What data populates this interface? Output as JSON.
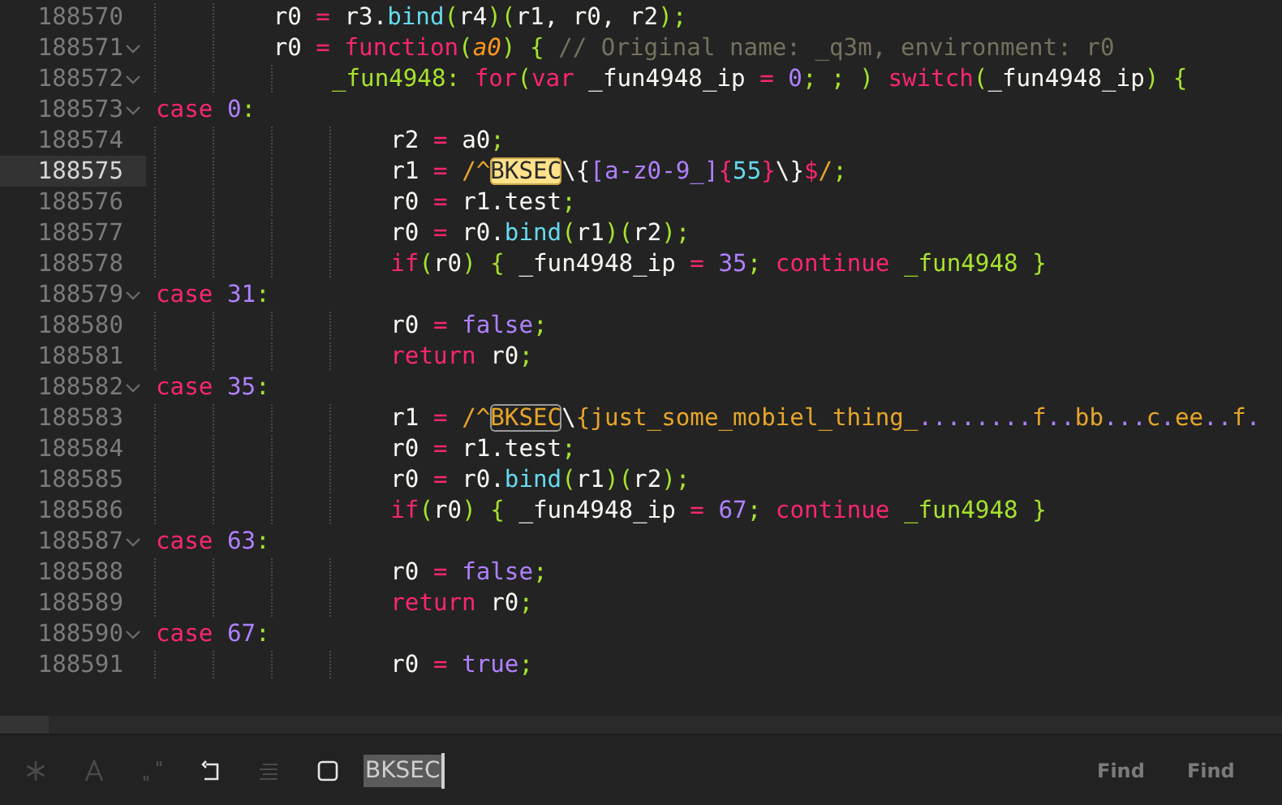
{
  "editor": {
    "lines": [
      {
        "number": "188570",
        "foldable": false,
        "current": false,
        "tokens": [
          {
            "kind": "plain",
            "text": "        r0 "
          },
          {
            "kind": "operator",
            "text": "= "
          },
          {
            "kind": "plain",
            "text": "r3."
          },
          {
            "kind": "func",
            "text": "bind"
          },
          {
            "kind": "punct",
            "text": "("
          },
          {
            "kind": "plain",
            "text": "r4"
          },
          {
            "kind": "punct",
            "text": ")("
          },
          {
            "kind": "plain",
            "text": "r1, r0, r2"
          },
          {
            "kind": "punct",
            "text": ");"
          }
        ]
      },
      {
        "number": "188571",
        "foldable": true,
        "current": false,
        "tokens": [
          {
            "kind": "plain",
            "text": "        r0 "
          },
          {
            "kind": "operator",
            "text": "= "
          },
          {
            "kind": "keyword",
            "text": "function"
          },
          {
            "kind": "punct",
            "text": "("
          },
          {
            "kind": "param",
            "text": "a0"
          },
          {
            "kind": "punct",
            "text": ") { "
          },
          {
            "kind": "comment",
            "text": "// Original name: _q3m, environment: r0"
          }
        ]
      },
      {
        "number": "188572",
        "foldable": true,
        "current": false,
        "tokens": [
          {
            "kind": "label",
            "text": "            _fun4948"
          },
          {
            "kind": "punct",
            "text": ": "
          },
          {
            "kind": "keyword",
            "text": "for"
          },
          {
            "kind": "punct",
            "text": "("
          },
          {
            "kind": "keyword",
            "text": "var "
          },
          {
            "kind": "plain",
            "text": "_fun4948_ip "
          },
          {
            "kind": "operator",
            "text": "= "
          },
          {
            "kind": "number",
            "text": "0"
          },
          {
            "kind": "punct",
            "text": "; ; ) "
          },
          {
            "kind": "keyword",
            "text": "switch"
          },
          {
            "kind": "punct",
            "text": "("
          },
          {
            "kind": "plain",
            "text": "_fun4948_ip"
          },
          {
            "kind": "punct",
            "text": ") {"
          }
        ]
      },
      {
        "number": "188573",
        "foldable": true,
        "current": false,
        "tokens": [
          {
            "kind": "keyword",
            "text": "case "
          },
          {
            "kind": "number",
            "text": "0"
          },
          {
            "kind": "punct",
            "text": ":"
          }
        ]
      },
      {
        "number": "188574",
        "foldable": false,
        "current": false,
        "tokens": [
          {
            "kind": "plain",
            "text": "                r2 "
          },
          {
            "kind": "operator",
            "text": "= "
          },
          {
            "kind": "plain",
            "text": "a0"
          },
          {
            "kind": "punct",
            "text": ";"
          }
        ]
      },
      {
        "number": "188575",
        "foldable": false,
        "current": true,
        "tokens": [
          {
            "kind": "plain",
            "text": "                r1 "
          },
          {
            "kind": "operator",
            "text": "= "
          },
          {
            "kind": "regex",
            "text": "/^"
          },
          {
            "kind": "match",
            "text": "BKSEC",
            "current": true
          },
          {
            "kind": "plain",
            "text": "\\{"
          },
          {
            "kind": "charclass",
            "text": "[a-z0-9_]"
          },
          {
            "kind": "operator",
            "text": "{"
          },
          {
            "kind": "func",
            "text": "55"
          },
          {
            "kind": "operator",
            "text": "}"
          },
          {
            "kind": "plain",
            "text": "\\}"
          },
          {
            "kind": "operator",
            "text": "$"
          },
          {
            "kind": "regex",
            "text": "/"
          },
          {
            "kind": "punct",
            "text": ";"
          }
        ]
      },
      {
        "number": "188576",
        "foldable": false,
        "current": false,
        "tokens": [
          {
            "kind": "plain",
            "text": "                r0 "
          },
          {
            "kind": "operator",
            "text": "= "
          },
          {
            "kind": "plain",
            "text": "r1.test"
          },
          {
            "kind": "punct",
            "text": ";"
          }
        ]
      },
      {
        "number": "188577",
        "foldable": false,
        "current": false,
        "tokens": [
          {
            "kind": "plain",
            "text": "                r0 "
          },
          {
            "kind": "operator",
            "text": "= "
          },
          {
            "kind": "plain",
            "text": "r0."
          },
          {
            "kind": "func",
            "text": "bind"
          },
          {
            "kind": "punct",
            "text": "("
          },
          {
            "kind": "plain",
            "text": "r1"
          },
          {
            "kind": "punct",
            "text": ")("
          },
          {
            "kind": "plain",
            "text": "r2"
          },
          {
            "kind": "punct",
            "text": ");"
          }
        ]
      },
      {
        "number": "188578",
        "foldable": false,
        "current": false,
        "tokens": [
          {
            "kind": "keyword",
            "text": "                if"
          },
          {
            "kind": "punct",
            "text": "("
          },
          {
            "kind": "plain",
            "text": "r0"
          },
          {
            "kind": "punct",
            "text": ") { "
          },
          {
            "kind": "plain",
            "text": "_fun4948_ip "
          },
          {
            "kind": "operator",
            "text": "= "
          },
          {
            "kind": "number",
            "text": "35"
          },
          {
            "kind": "punct",
            "text": "; "
          },
          {
            "kind": "keyword",
            "text": "continue "
          },
          {
            "kind": "label",
            "text": "_fun4948"
          },
          {
            "kind": "punct",
            "text": " }"
          }
        ]
      },
      {
        "number": "188579",
        "foldable": true,
        "current": false,
        "tokens": [
          {
            "kind": "keyword",
            "text": "case "
          },
          {
            "kind": "number",
            "text": "31"
          },
          {
            "kind": "punct",
            "text": ":"
          }
        ]
      },
      {
        "number": "188580",
        "foldable": false,
        "current": false,
        "tokens": [
          {
            "kind": "plain",
            "text": "                r0 "
          },
          {
            "kind": "operator",
            "text": "= "
          },
          {
            "kind": "number",
            "text": "false"
          },
          {
            "kind": "punct",
            "text": ";"
          }
        ]
      },
      {
        "number": "188581",
        "foldable": false,
        "current": false,
        "tokens": [
          {
            "kind": "keyword",
            "text": "                return "
          },
          {
            "kind": "plain",
            "text": "r0"
          },
          {
            "kind": "punct",
            "text": ";"
          }
        ]
      },
      {
        "number": "188582",
        "foldable": true,
        "current": false,
        "tokens": [
          {
            "kind": "keyword",
            "text": "case "
          },
          {
            "kind": "number",
            "text": "35"
          },
          {
            "kind": "punct",
            "text": ":"
          }
        ]
      },
      {
        "number": "188583",
        "foldable": false,
        "current": false,
        "tokens": [
          {
            "kind": "plain",
            "text": "                r1 "
          },
          {
            "kind": "operator",
            "text": "= "
          },
          {
            "kind": "regex",
            "text": "/^"
          },
          {
            "kind": "match",
            "text": "BKSEC",
            "current": false
          },
          {
            "kind": "plain",
            "text": "\\"
          },
          {
            "kind": "regex",
            "text": "{just_some_mobiel_thing_"
          },
          {
            "kind": "charclass",
            "text": "........"
          },
          {
            "kind": "regex",
            "text": "f"
          },
          {
            "kind": "charclass",
            "text": ".."
          },
          {
            "kind": "regex",
            "text": "bb"
          },
          {
            "kind": "charclass",
            "text": "..."
          },
          {
            "kind": "regex",
            "text": "c"
          },
          {
            "kind": "charclass",
            "text": "."
          },
          {
            "kind": "regex",
            "text": "ee"
          },
          {
            "kind": "charclass",
            "text": ".."
          },
          {
            "kind": "regex",
            "text": "f"
          },
          {
            "kind": "charclass",
            "text": "."
          }
        ]
      },
      {
        "number": "188584",
        "foldable": false,
        "current": false,
        "tokens": [
          {
            "kind": "plain",
            "text": "                r0 "
          },
          {
            "kind": "operator",
            "text": "= "
          },
          {
            "kind": "plain",
            "text": "r1.test"
          },
          {
            "kind": "punct",
            "text": ";"
          }
        ]
      },
      {
        "number": "188585",
        "foldable": false,
        "current": false,
        "tokens": [
          {
            "kind": "plain",
            "text": "                r0 "
          },
          {
            "kind": "operator",
            "text": "= "
          },
          {
            "kind": "plain",
            "text": "r0."
          },
          {
            "kind": "func",
            "text": "bind"
          },
          {
            "kind": "punct",
            "text": "("
          },
          {
            "kind": "plain",
            "text": "r1"
          },
          {
            "kind": "punct",
            "text": ")("
          },
          {
            "kind": "plain",
            "text": "r2"
          },
          {
            "kind": "punct",
            "text": ");"
          }
        ]
      },
      {
        "number": "188586",
        "foldable": false,
        "current": false,
        "tokens": [
          {
            "kind": "keyword",
            "text": "                if"
          },
          {
            "kind": "punct",
            "text": "("
          },
          {
            "kind": "plain",
            "text": "r0"
          },
          {
            "kind": "punct",
            "text": ") { "
          },
          {
            "kind": "plain",
            "text": "_fun4948_ip "
          },
          {
            "kind": "operator",
            "text": "= "
          },
          {
            "kind": "number",
            "text": "67"
          },
          {
            "kind": "punct",
            "text": "; "
          },
          {
            "kind": "keyword",
            "text": "continue "
          },
          {
            "kind": "label",
            "text": "_fun4948"
          },
          {
            "kind": "punct",
            "text": " }"
          }
        ]
      },
      {
        "number": "188587",
        "foldable": true,
        "current": false,
        "tokens": [
          {
            "kind": "keyword",
            "text": "case "
          },
          {
            "kind": "number",
            "text": "63"
          },
          {
            "kind": "punct",
            "text": ":"
          }
        ]
      },
      {
        "number": "188588",
        "foldable": false,
        "current": false,
        "tokens": [
          {
            "kind": "plain",
            "text": "                r0 "
          },
          {
            "kind": "operator",
            "text": "= "
          },
          {
            "kind": "number",
            "text": "false"
          },
          {
            "kind": "punct",
            "text": ";"
          }
        ]
      },
      {
        "number": "188589",
        "foldable": false,
        "current": false,
        "tokens": [
          {
            "kind": "keyword",
            "text": "                return "
          },
          {
            "kind": "plain",
            "text": "r0"
          },
          {
            "kind": "punct",
            "text": ";"
          }
        ]
      },
      {
        "number": "188590",
        "foldable": true,
        "current": false,
        "tokens": [
          {
            "kind": "keyword",
            "text": "case "
          },
          {
            "kind": "number",
            "text": "67"
          },
          {
            "kind": "punct",
            "text": ":"
          }
        ]
      },
      {
        "number": "188591",
        "foldable": false,
        "current": false,
        "tokens": [
          {
            "kind": "plain",
            "text": "                r0 "
          },
          {
            "kind": "operator",
            "text": "= "
          },
          {
            "kind": "number",
            "text": "true"
          },
          {
            "kind": "punct",
            "text": ";"
          }
        ]
      }
    ]
  },
  "find_panel": {
    "toggles": [
      {
        "kind": "regex",
        "on": false
      },
      {
        "kind": "case",
        "on": false
      },
      {
        "kind": "word",
        "on": false
      },
      {
        "kind": "wrap",
        "on": true
      },
      {
        "kind": "selection",
        "on": false
      },
      {
        "kind": "highlight",
        "on": true
      }
    ],
    "search": {
      "value": "BKSEC"
    },
    "buttons": [
      "Find",
      "Find"
    ]
  }
}
